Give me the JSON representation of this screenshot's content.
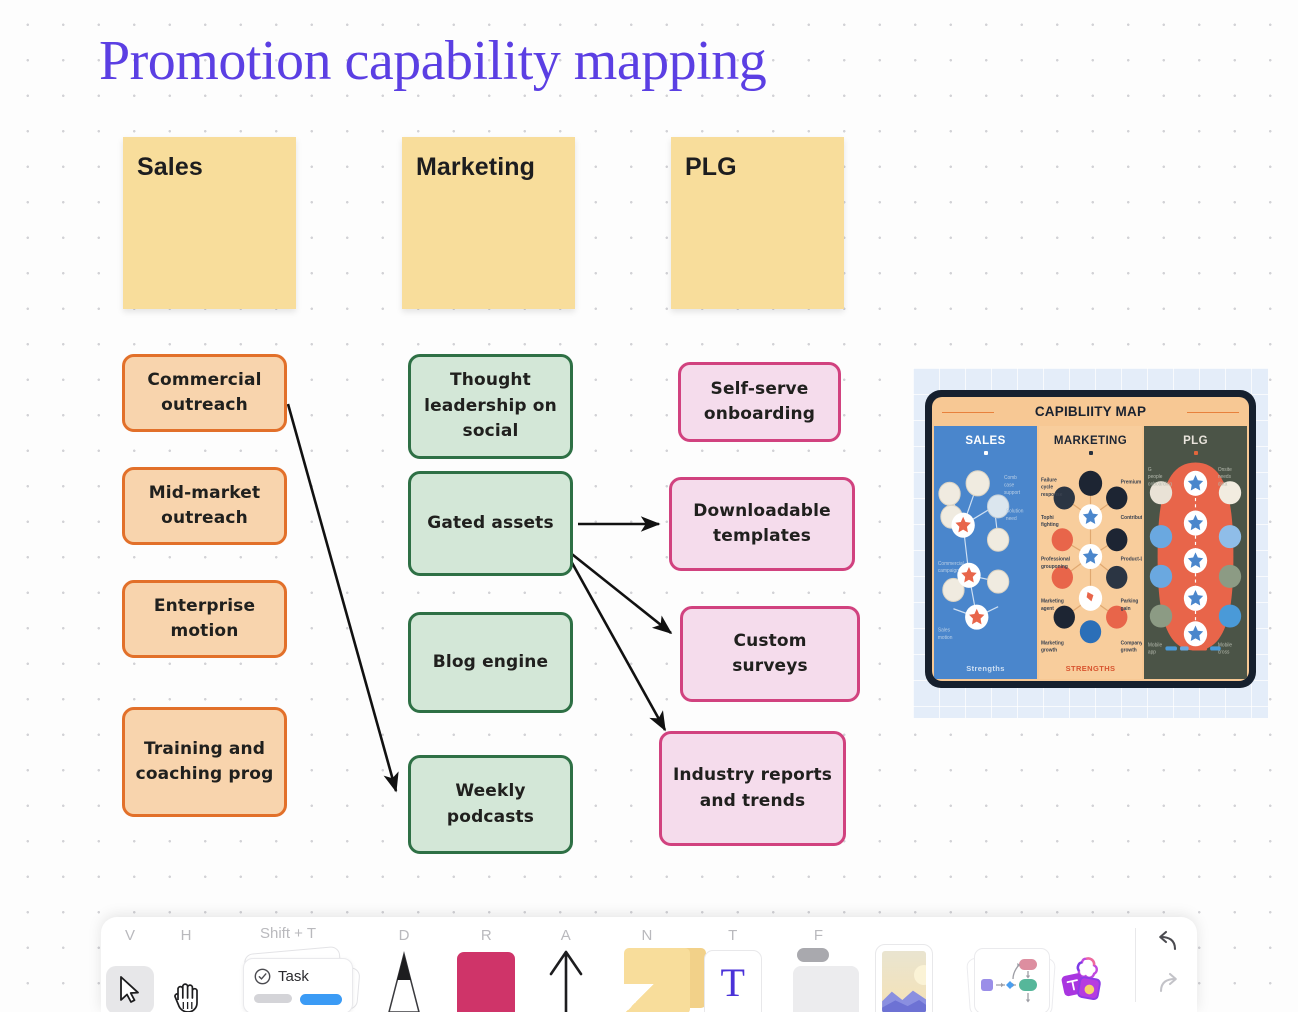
{
  "board": {
    "title": "Promotion capability mapping",
    "title_color": "#5b3fe3",
    "background": "#fdfdfd"
  },
  "columns": [
    {
      "label": "Sales",
      "color": "#f8dd9b"
    },
    {
      "label": "Marketing",
      "color": "#f8dd9b"
    },
    {
      "label": "PLG",
      "color": "#f8dd9b"
    }
  ],
  "cards": {
    "sales": [
      {
        "label": "Commercial outreach"
      },
      {
        "label": "Mid-market outreach"
      },
      {
        "label": "Enterprise motion"
      },
      {
        "label": "Training and coaching prog"
      }
    ],
    "marketing": [
      {
        "label": "Thought leadership on social"
      },
      {
        "label": "Gated assets"
      },
      {
        "label": "Blog engine"
      },
      {
        "label": "Weekly podcasts"
      }
    ],
    "plg": [
      {
        "label": "Self-serve onboarding"
      },
      {
        "label": "Downloadable templates"
      },
      {
        "label": "Custom surveys"
      },
      {
        "label": "Industry reports and trends"
      }
    ]
  },
  "card_colors": {
    "sales_fill": "#f8d4ad",
    "sales_border": "#e2702a",
    "marketing_fill": "#d3e7d7",
    "marketing_border": "#2e7045",
    "plg_fill": "#f5dcec",
    "plg_border": "#d1427f"
  },
  "connectors": [
    {
      "from": "Commercial outreach",
      "to": "Weekly podcasts"
    },
    {
      "from": "Gated assets",
      "to": "Downloadable templates"
    },
    {
      "from": "Gated assets",
      "to": "Custom surveys"
    },
    {
      "from": "Gated assets",
      "to": "Industry reports and trends"
    }
  ],
  "capability_map_image": {
    "title": "CAPIBLIITY MAP",
    "columns": [
      {
        "name": "SALES",
        "footer": "Strengths",
        "fill": "#4a86cc"
      },
      {
        "name": "MARKETING",
        "footer": "STRENGTHS",
        "fill": "#f8cd9c"
      },
      {
        "name": "PLG",
        "footer": "",
        "fill": "#4b5447"
      }
    ]
  },
  "toolbar": {
    "tools": [
      {
        "name": "select",
        "hint": "V",
        "icon": "cursor-icon",
        "selected": true
      },
      {
        "name": "hand",
        "hint": "H",
        "icon": "hand-icon",
        "selected": false
      },
      {
        "name": "task",
        "hint": "Shift + T",
        "icon": "task-card-icon",
        "label": "Task",
        "selected": false
      },
      {
        "name": "pen",
        "hint": "D",
        "icon": "pen-icon",
        "selected": false
      },
      {
        "name": "shape",
        "hint": "R",
        "icon": "rectangle-icon",
        "selected": false
      },
      {
        "name": "arrow",
        "hint": "A",
        "icon": "arrow-up-icon",
        "selected": false
      },
      {
        "name": "sticky",
        "hint": "N",
        "icon": "sticky-note-icon",
        "selected": false
      },
      {
        "name": "text",
        "hint": "T",
        "icon": "text-icon",
        "label": "T",
        "selected": false
      },
      {
        "name": "frame",
        "hint": "F",
        "icon": "frame-icon",
        "selected": false
      },
      {
        "name": "image",
        "hint": "",
        "icon": "image-icon",
        "selected": false
      },
      {
        "name": "template",
        "hint": "",
        "icon": "flowchart-icon",
        "selected": false
      },
      {
        "name": "apps",
        "hint": "",
        "icon": "apps-icon",
        "selected": false
      }
    ],
    "undo": "undo-icon",
    "redo": "redo-icon"
  }
}
